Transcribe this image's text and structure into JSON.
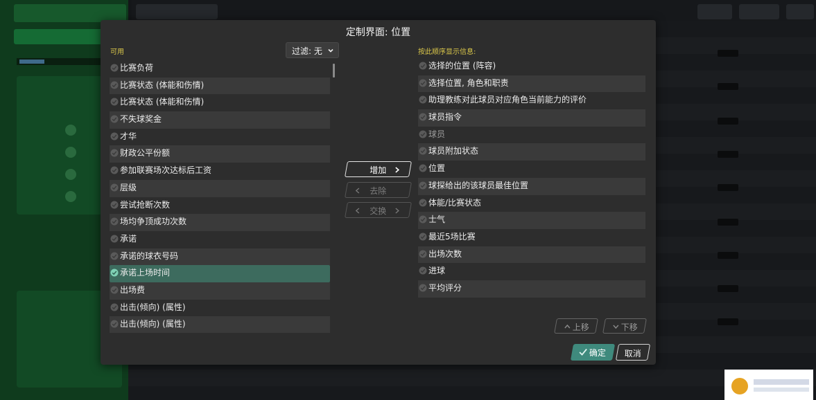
{
  "dialog": {
    "title": "定制界面: 位置",
    "available_label": "可用",
    "filter_label": "过滤: 无",
    "order_label": "按此顺序显示信息:",
    "available_items": [
      {
        "label": "比赛负荷",
        "selected": false
      },
      {
        "label": "比赛状态 (体能和伤情)",
        "selected": false
      },
      {
        "label": "比赛状态 (体能和伤情)",
        "selected": false
      },
      {
        "label": "不失球奖金",
        "selected": false
      },
      {
        "label": "才华",
        "selected": false
      },
      {
        "label": "财政公平份额",
        "selected": false
      },
      {
        "label": "参加联赛场次达标后工资",
        "selected": false
      },
      {
        "label": "层级",
        "selected": false
      },
      {
        "label": "尝试抢断次数",
        "selected": false
      },
      {
        "label": "场均争顶成功次数",
        "selected": false
      },
      {
        "label": "承诺",
        "selected": false
      },
      {
        "label": "承诺的球衣号码",
        "selected": false
      },
      {
        "label": "承诺上场时间",
        "selected": true
      },
      {
        "label": "出场费",
        "selected": false
      },
      {
        "label": "出击(倾向) (属性)",
        "selected": false
      },
      {
        "label": "出击(倾向) (属性)",
        "selected": false
      }
    ],
    "display_items": [
      {
        "label": "选择的位置 (阵容)",
        "dim": false
      },
      {
        "label": "选择位置, 角色和职责",
        "dim": false
      },
      {
        "label": "助理教练对此球员对应角色当前能力的评价",
        "dim": false
      },
      {
        "label": "球员指令",
        "dim": false
      },
      {
        "label": "球员",
        "dim": true
      },
      {
        "label": "球员附加状态",
        "dim": false
      },
      {
        "label": "位置",
        "dim": false
      },
      {
        "label": "球探给出的该球员最佳位置",
        "dim": false
      },
      {
        "label": "体能/比赛状态",
        "dim": false
      },
      {
        "label": "士气",
        "dim": false
      },
      {
        "label": "最近5场比赛",
        "dim": false
      },
      {
        "label": "出场次数",
        "dim": false
      },
      {
        "label": "进球",
        "dim": false
      },
      {
        "label": "平均评分",
        "dim": false
      }
    ],
    "buttons": {
      "add": "增加",
      "remove": "去除",
      "swap": "交换",
      "move_up": "上移",
      "move_down": "下移",
      "ok": "确定",
      "cancel": "取消"
    },
    "colors": {
      "accent": "#3f8a7d",
      "selected_row": "#3d6b5e",
      "section_label": "#d9c64a",
      "dialog_bg": "#2d2d2d"
    },
    "icons": [
      "check-circle-icon",
      "chevron-down-icon",
      "chevron-right-icon",
      "chevron-left-icon",
      "checkmark-icon"
    ]
  }
}
